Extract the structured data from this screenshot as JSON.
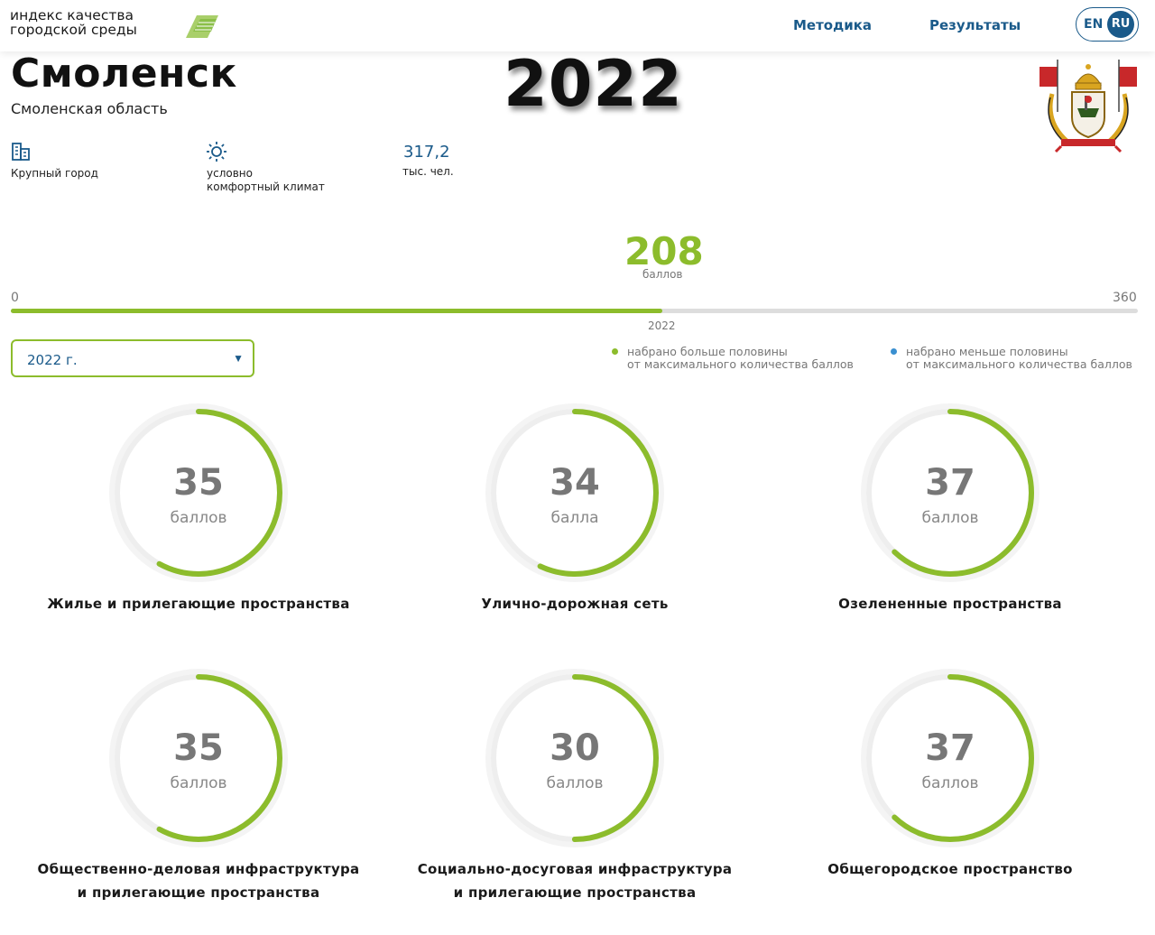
{
  "header": {
    "logo_line1": "индекс качества",
    "logo_line2": "городской среды",
    "nav": {
      "method": "Методика",
      "results": "Результаты"
    },
    "lang": {
      "en": "EN",
      "ru": "RU",
      "active": "RU"
    }
  },
  "city": {
    "name": "Смоленск",
    "region": "Смоленская область",
    "year_overlay": "2022"
  },
  "facts": {
    "size": "Крупный город",
    "climate_line1": "условно",
    "climate_line2": "комфортный климат",
    "population_value": "317,2",
    "population_unit": "тыс. чел."
  },
  "total": {
    "score": "208",
    "unit": "баллов",
    "min": "0",
    "max": "360",
    "year": "2022",
    "progress_fraction": 0.578
  },
  "year_select": {
    "value": "2022 г."
  },
  "legend": {
    "more_line1": "набрано больше половины",
    "more_line2": "от максимального количества баллов",
    "less_line1": "набрано меньше половины",
    "less_line2": "от максимального количества баллов",
    "more_color": "#8cbc2c",
    "less_color": "#3a8fd0"
  },
  "categories": [
    {
      "value": "35",
      "unit": "баллов",
      "fraction": 0.58,
      "title_line1": "Жилье и прилегающие пространства",
      "title_line2": ""
    },
    {
      "value": "34",
      "unit": "балла",
      "fraction": 0.57,
      "title_line1": "Улично-дорожная сеть",
      "title_line2": ""
    },
    {
      "value": "37",
      "unit": "баллов",
      "fraction": 0.62,
      "title_line1": "Озелененные пространства",
      "title_line2": ""
    },
    {
      "value": "35",
      "unit": "баллов",
      "fraction": 0.58,
      "title_line1": "Общественно-деловая инфраструктура",
      "title_line2": "и прилегающие пространства"
    },
    {
      "value": "30",
      "unit": "баллов",
      "fraction": 0.5,
      "title_line1": "Социально-досуговая инфраструктура",
      "title_line2": "и прилегающие пространства"
    },
    {
      "value": "37",
      "unit": "баллов",
      "fraction": 0.62,
      "title_line1": "Общегородское пространство",
      "title_line2": ""
    }
  ],
  "colors": {
    "accent_green": "#8cbc2c",
    "brand_blue": "#1a5a8a",
    "ring_track": "#eeeeee"
  }
}
